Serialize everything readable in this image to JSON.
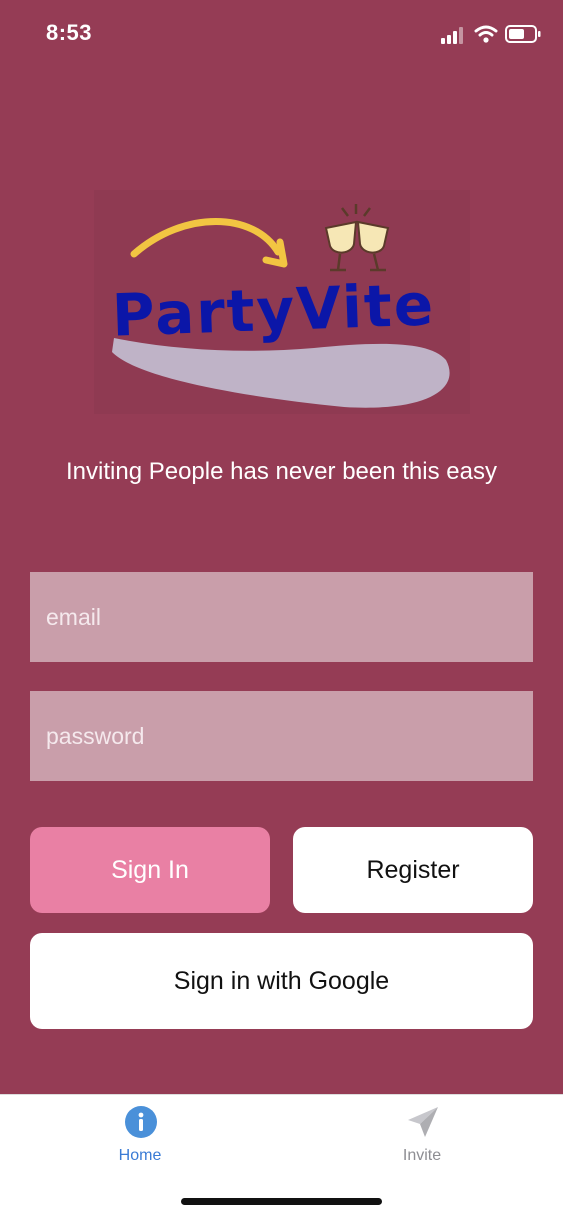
{
  "status_bar": {
    "time": "8:53"
  },
  "logo": {
    "brand": "PartyVite"
  },
  "tagline": "Inviting People has never been this easy",
  "form": {
    "email_placeholder": "email",
    "email_value": "",
    "password_placeholder": "password",
    "password_value": ""
  },
  "buttons": {
    "sign_in": "Sign In",
    "register": "Register",
    "google": "Sign in with Google"
  },
  "tabs": [
    {
      "label": "Home",
      "icon": "info-icon",
      "active": true
    },
    {
      "label": "Invite",
      "icon": "paper-plane-icon",
      "active": false
    }
  ],
  "colors": {
    "background": "#953c55",
    "input": "#c99eaa",
    "sign_in_button": "#e980a4",
    "active_tab": "#3a7bd5"
  }
}
